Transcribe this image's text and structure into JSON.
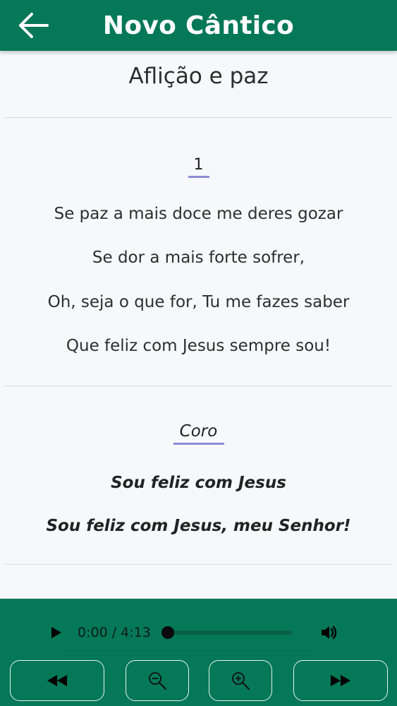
{
  "header": {
    "title": "Novo Cântico",
    "back_icon": "arrow-left-icon"
  },
  "song": {
    "title": "Aflição e paz",
    "verse": {
      "number": "1",
      "lines": [
        "Se paz a mais doce me deres gozar",
        "Se dor a mais forte sofrer,",
        "Oh, seja o que for, Tu me fazes saber",
        "Que feliz com Jesus sempre sou!"
      ]
    },
    "chorus": {
      "label": "Coro",
      "lines": [
        "Sou feliz com Jesus",
        "Sou feliz com Jesus, meu Senhor!"
      ]
    }
  },
  "player": {
    "time": "0:00 / 4:13",
    "progress": 0,
    "play_icon": "play-icon",
    "volume_icon": "volume-icon",
    "controls": [
      "rewind-icon",
      "zoom-out-icon",
      "zoom-in-icon",
      "fast-forward-icon"
    ]
  },
  "colors": {
    "header_bg": "#047857",
    "player_bg": "#047857",
    "accent_underline": "#8b8dd6"
  }
}
